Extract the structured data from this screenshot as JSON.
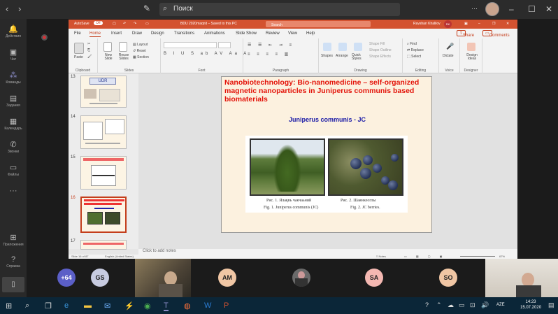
{
  "teams": {
    "search_placeholder": "Поиск",
    "rail": [
      "Действия",
      "Чат",
      "Команды",
      "Задания",
      "Календарь",
      "Звонки",
      "Файлы",
      "Приложения",
      "Справка"
    ]
  },
  "ppt": {
    "autosave_label": "AutoSave",
    "autosave_state": "Off",
    "file_title": "BDU 2020maqnit – Saved to this PC",
    "search_label": "Search",
    "user": "Ravshan Khalilov",
    "user_initials": "RK",
    "tabs": [
      "File",
      "Home",
      "Insert",
      "Draw",
      "Design",
      "Transitions",
      "Animations",
      "Slide Show",
      "Review",
      "View",
      "Help"
    ],
    "share": "Share",
    "comments": "Comments",
    "ribbon": {
      "clipboard": "Clipboard",
      "paste": "Paste",
      "slides": "Slides",
      "new_slide": "New Slide",
      "reuse_slides": "Reuse Slides",
      "layout": "Layout",
      "reset": "Reset",
      "section": "Section",
      "font": "Font",
      "paragraph": "Paragraph",
      "drawing": "Drawing",
      "shapes": "Shapes",
      "arrange": "Arrange",
      "quick_styles": "Quick Styles",
      "shape_fill": "Shape Fill",
      "shape_outline": "Shape Outline",
      "shape_effects": "Shape Effects",
      "editing": "Editing",
      "find": "Find",
      "replace": "Replace",
      "select": "Select",
      "voice": "Voice",
      "dictate": "Dictate",
      "designer": "Designer",
      "design_ideas": "Design Ideas"
    },
    "thumb_numbers": [
      "13",
      "14",
      "15",
      "16",
      "17"
    ],
    "thumb13_title": "UDR",
    "selected_thumb": "16",
    "slide": {
      "title": "Nanobiotechnology: Bio-nanomedicine – self-organized magnetic nanoparticles in Juniperus communis based biomaterials",
      "subtitle": "Juniperus communis - JC",
      "cap1_ru": "Рис. 1. Ялақвь чакчаьний",
      "cap2_ru": "Рис. 2. Шаянкеоглы",
      "cap1_en": "Fig. 1. Juniperus communis (JC)",
      "cap2_en": "Fig. 2. JC berries."
    },
    "notes_placeholder": "Click to add notes",
    "status_slide": "Slide 16 of 87",
    "status_lang": "English (United States)",
    "status_notes": "Notes",
    "zoom": "67%"
  },
  "participants": {
    "overflow": "+64",
    "chips": [
      {
        "initials": "GS",
        "color": "#c7cbe0"
      },
      {
        "initials": "AM",
        "color": "#f0c6a4"
      },
      {
        "initials": "SA",
        "color": "#f4b8b2"
      },
      {
        "initials": "SO",
        "color": "#f0c6a4"
      }
    ]
  },
  "taskbar": {
    "time": "14:23",
    "date": "15.07.2020",
    "lang": "AZE"
  }
}
